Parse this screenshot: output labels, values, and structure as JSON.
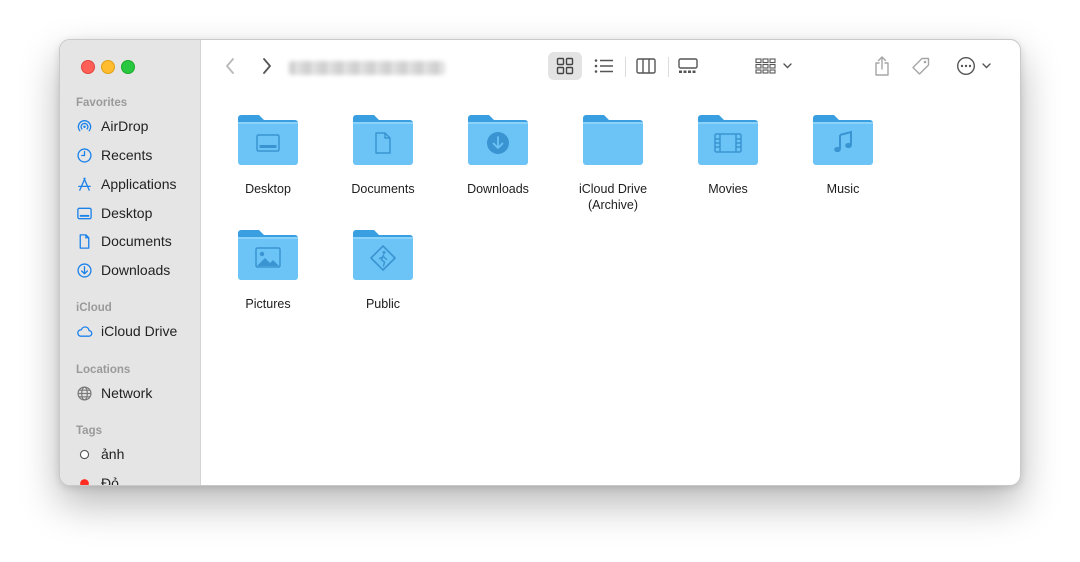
{
  "sidebar": {
    "favorites_heading": "Favorites",
    "favorites": [
      {
        "label": "AirDrop",
        "icon": "airdrop-icon"
      },
      {
        "label": "Recents",
        "icon": "clock-icon"
      },
      {
        "label": "Applications",
        "icon": "applications-icon"
      },
      {
        "label": "Desktop",
        "icon": "desktop-icon"
      },
      {
        "label": "Documents",
        "icon": "document-icon"
      },
      {
        "label": "Downloads",
        "icon": "download-icon"
      }
    ],
    "icloud_heading": "iCloud",
    "icloud": [
      {
        "label": "iCloud Drive",
        "icon": "cloud-icon"
      }
    ],
    "locations_heading": "Locations",
    "locations": [
      {
        "label": "Network",
        "icon": "globe-icon"
      }
    ],
    "tags_heading": "Tags",
    "tags": [
      {
        "label": "ảnh",
        "color": "#ffffff"
      },
      {
        "label": "Đỏ",
        "color": "#ff2d21"
      }
    ]
  },
  "toolbar": {
    "title_obscured": true,
    "view_selected": "icon"
  },
  "folders": [
    {
      "label": "Desktop",
      "glyph": "desktop"
    },
    {
      "label": "Documents",
      "glyph": "document"
    },
    {
      "label": "Downloads",
      "glyph": "download"
    },
    {
      "label": "iCloud Drive\n(Archive)",
      "glyph": "none"
    },
    {
      "label": "Movies",
      "glyph": "film"
    },
    {
      "label": "Music",
      "glyph": "music"
    },
    {
      "label": "Pictures",
      "glyph": "picture"
    },
    {
      "label": "Public",
      "glyph": "public"
    }
  ],
  "colors": {
    "accent": "#1b82ea",
    "folder_body": "#6cc3f5",
    "folder_tab": "#3a9fe0"
  }
}
